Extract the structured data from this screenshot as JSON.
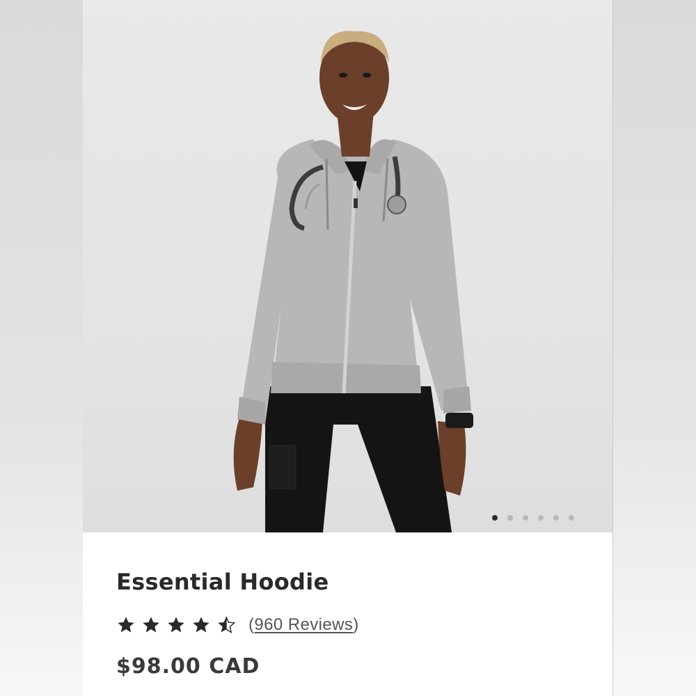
{
  "product": {
    "name": "Essential Hoodie",
    "rating": 4.5,
    "rating_max": 5,
    "reviews_open": "(",
    "reviews_link": "960 Reviews",
    "reviews_close": ")",
    "price": "$98.00 CAD"
  },
  "carousel": {
    "total_slides": 6,
    "active_index": 0
  },
  "icons": {
    "star": "star-icon",
    "half_star": "half-star-icon"
  },
  "colors": {
    "star": "#2a2a2a",
    "active_dot": "#2b2b2b",
    "inactive_dot": "#b8b8b8"
  }
}
